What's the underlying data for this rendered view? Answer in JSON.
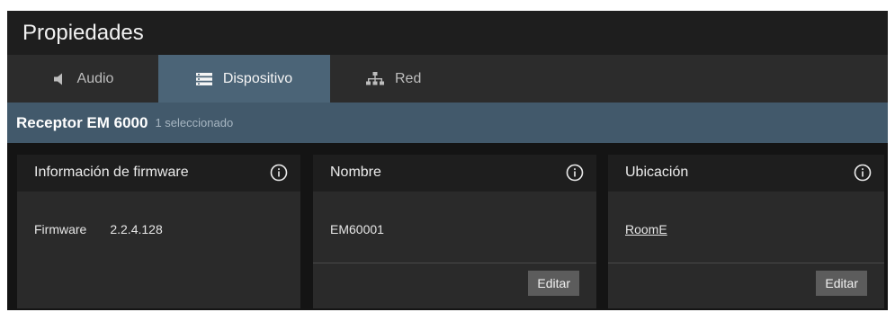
{
  "panel": {
    "title": "Propiedades"
  },
  "tabs": [
    {
      "label": "Audio",
      "icon": "speaker-icon",
      "active": false
    },
    {
      "label": "Dispositivo",
      "icon": "device-list-icon",
      "active": true
    },
    {
      "label": "Red",
      "icon": "network-icon",
      "active": false
    }
  ],
  "selection": {
    "device": "Receptor EM 6000",
    "count": "1 seleccionado"
  },
  "cards": {
    "firmware": {
      "title": "Información de firmware",
      "label": "Firmware",
      "value": "2.2.4.128"
    },
    "nombre": {
      "title": "Nombre",
      "value": "EM60001",
      "edit_label": "Editar"
    },
    "ubicacion": {
      "title": "Ubicación",
      "value": "RoomE",
      "edit_label": "Editar"
    }
  },
  "colors": {
    "active_tab": "#4b6477",
    "selection_bar": "#42596b"
  }
}
